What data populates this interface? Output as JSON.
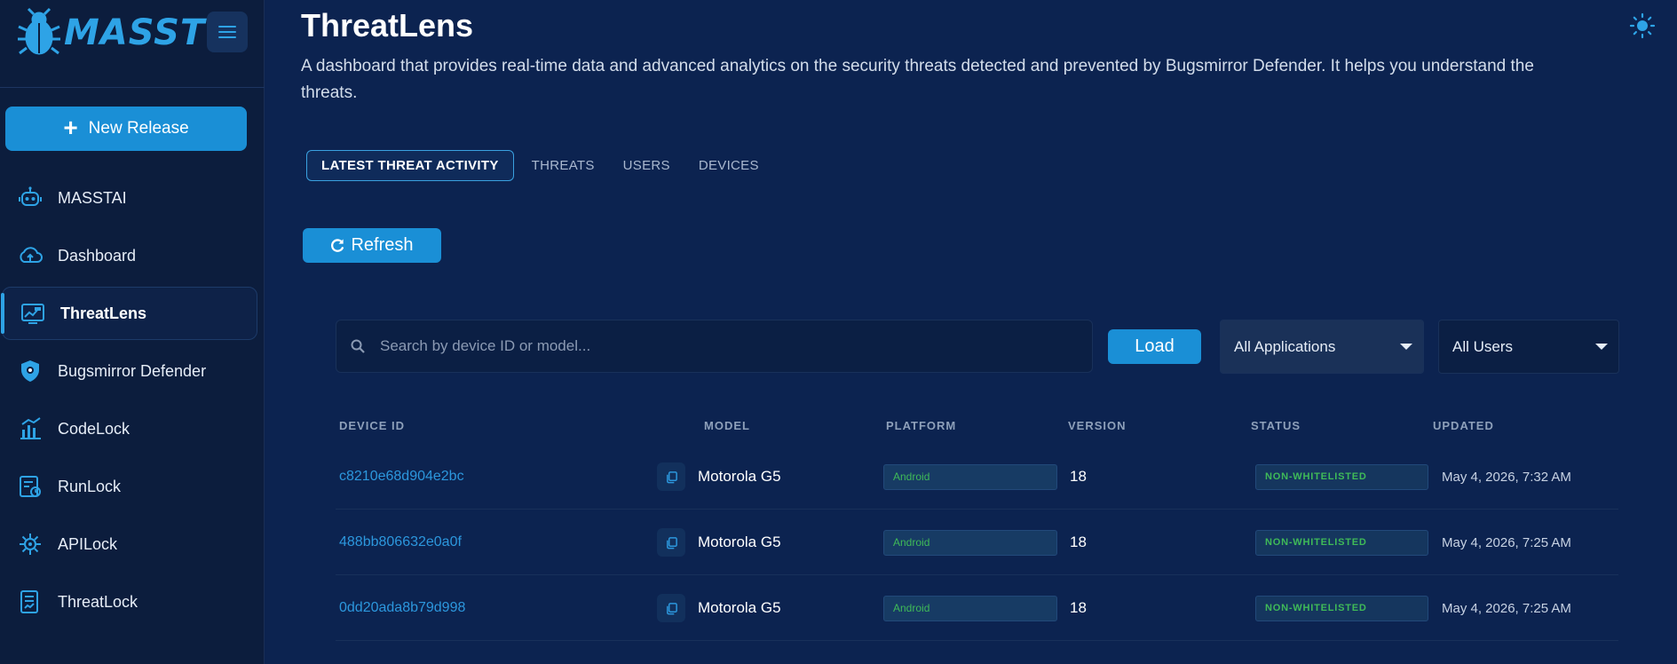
{
  "brand": {
    "name": "MASST"
  },
  "sidebar": {
    "new_release_label": "New Release",
    "items": [
      {
        "label": "MASSTAI",
        "icon": "robot-icon"
      },
      {
        "label": "Dashboard",
        "icon": "cloud-icon"
      },
      {
        "label": "ThreatLens",
        "icon": "monitor-chart-icon",
        "active": true
      },
      {
        "label": "Bugsmirror Defender",
        "icon": "shield-icon"
      },
      {
        "label": "CodeLock",
        "icon": "code-chart-icon"
      },
      {
        "label": "RunLock",
        "icon": "runtime-lock-icon"
      },
      {
        "label": "APILock",
        "icon": "api-gear-icon"
      },
      {
        "label": "ThreatLock",
        "icon": "threat-report-icon"
      }
    ]
  },
  "page": {
    "title": "ThreatLens",
    "description": "A dashboard that provides real-time data and advanced analytics on the security threats detected and prevented by Bugsmirror Defender. It helps you understand the threats."
  },
  "tabs": [
    {
      "label": "LATEST THREAT ACTIVITY",
      "active": true
    },
    {
      "label": "THREATS"
    },
    {
      "label": "USERS"
    },
    {
      "label": "DEVICES"
    }
  ],
  "toolbar": {
    "refresh_label": "Refresh",
    "search_placeholder": "Search by device ID or model...",
    "load_label": "Load",
    "applications_filter": "All Applications",
    "users_filter": "All Users"
  },
  "table": {
    "columns": [
      "DEVICE ID",
      "MODEL",
      "PLATFORM",
      "VERSION",
      "STATUS",
      "UPDATED"
    ],
    "rows": [
      {
        "device_id": "c8210e68d904e2bc",
        "model": "Motorola G5",
        "platform": "Android",
        "version": "18",
        "status": "NON-WHITELISTED",
        "updated": "May 4, 2026, 7:32 AM"
      },
      {
        "device_id": "488bb806632e0a0f",
        "model": "Motorola G5",
        "platform": "Android",
        "version": "18",
        "status": "NON-WHITELISTED",
        "updated": "May 4, 2026, 7:25 AM"
      },
      {
        "device_id": "0dd20ada8b79d998",
        "model": "Motorola G5",
        "platform": "Android",
        "version": "18",
        "status": "NON-WHITELISTED",
        "updated": "May 4, 2026, 7:25 AM"
      }
    ]
  },
  "colors": {
    "accent": "#1a8fd6",
    "background": "#0c2350",
    "sidebar": "#0c1d3d",
    "status_text": "#3fba58"
  }
}
